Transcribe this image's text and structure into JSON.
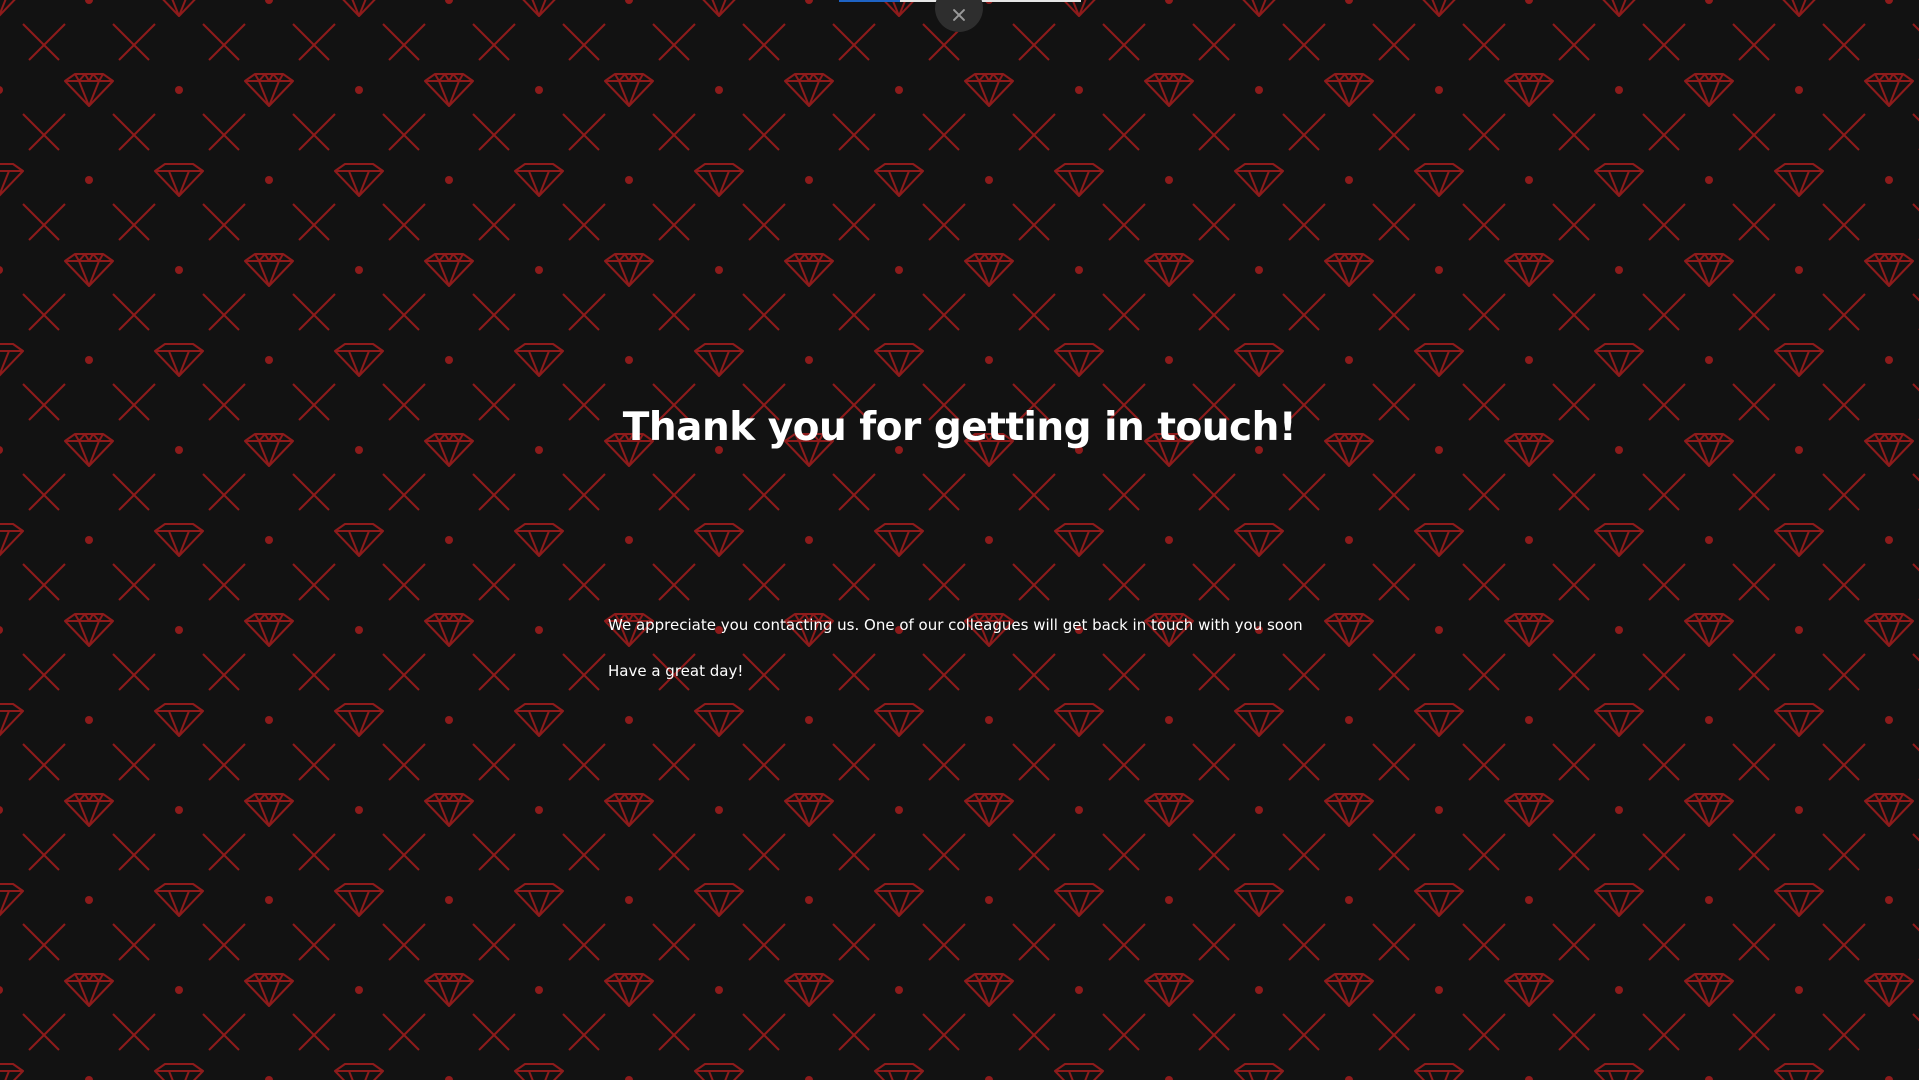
{
  "page": {
    "background_color": "#121212",
    "pattern_color": "#8e1b1b",
    "pattern_icon": "diamond-icon"
  },
  "top_bar": {
    "progress_fraction": 0.25,
    "progress_color": "#1e63c4",
    "close_icon": "close-icon"
  },
  "thank_you": {
    "title": "Thank you for getting in touch!",
    "message": "We appreciate you contacting us. One of our colleagues will get back in touch with you soon",
    "sign_off": "Have a great day!"
  }
}
